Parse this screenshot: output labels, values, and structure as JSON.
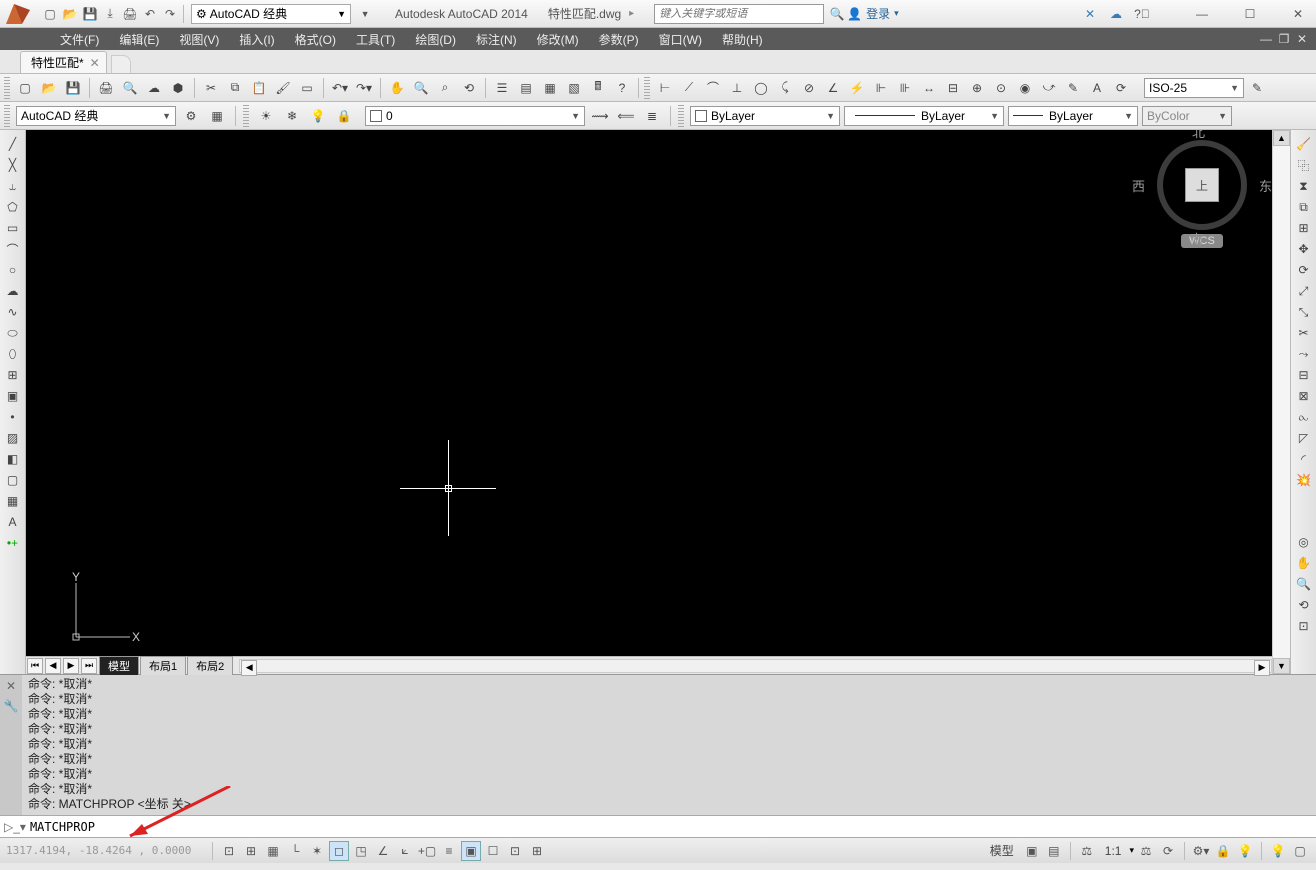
{
  "title": {
    "app": "Autodesk AutoCAD 2014",
    "file": "特性匹配.dwg",
    "workspace": "AutoCAD 经典",
    "search_placeholder": "键入关键字或短语",
    "login": "登录"
  },
  "menu": [
    "文件(F)",
    "编辑(E)",
    "视图(V)",
    "插入(I)",
    "格式(O)",
    "工具(T)",
    "绘图(D)",
    "标注(N)",
    "修改(M)",
    "参数(P)",
    "窗口(W)",
    "帮助(H)"
  ],
  "tab": {
    "name": "特性匹配*",
    "modified": true
  },
  "dim_style": "ISO-25",
  "props": {
    "workspace": "AutoCAD 经典",
    "layer": "0",
    "color": "ByLayer",
    "linetype": "ByLayer",
    "lineweight": "ByLayer",
    "plotstyle": "ByColor"
  },
  "layout_tabs": {
    "active": "模型",
    "others": [
      "布局1",
      "布局2"
    ]
  },
  "viewcube": {
    "top": "上",
    "n": "北",
    "s": "南",
    "e": "东",
    "w": "西",
    "wcs": "WCS"
  },
  "ucs": {
    "x": "X",
    "y": "Y"
  },
  "command_history": [
    "命令: *取消*",
    "命令: *取消*",
    "命令: *取消*",
    "命令: *取消*",
    "命令: *取消*",
    "命令: *取消*",
    "命令: *取消*",
    "命令: *取消*",
    "命令: MATCHPROP <坐标 关>"
  ],
  "command_input": "MATCHPROP",
  "status": {
    "coords": "1317.4194, -18.4264 , 0.0000",
    "model": "模型",
    "scale": "1:1"
  },
  "qat_icons": [
    "new",
    "open",
    "save",
    "saveall",
    "print",
    "undo",
    "redo"
  ],
  "toolbar1": [
    "new",
    "open",
    "save",
    "print",
    "preview",
    "publish",
    "3d",
    "cut",
    "copy",
    "paste",
    "matchprop",
    "block",
    "undo",
    "redo",
    "pan",
    "zoomrt",
    "zoomwin",
    "zoomext",
    "props",
    "sheet",
    "layer",
    "tool",
    "calc",
    "help"
  ],
  "dim_toolbar": [
    "linear",
    "aligned",
    "arc",
    "ordinate",
    "radius",
    "diameter",
    "angular",
    "quick",
    "baseline",
    "continue",
    "spacing",
    "break",
    "tolerance",
    "center",
    "inspect",
    "jog",
    "edit",
    "textedit",
    "update",
    "style"
  ],
  "left_tools": [
    "line",
    "xline",
    "pline",
    "polygon",
    "rect",
    "arc",
    "circle",
    "revcloud",
    "spline",
    "ellipse",
    "ellarc",
    "insert",
    "block",
    "point",
    "hatch",
    "gradient",
    "region",
    "table",
    "mtext",
    "addpoint"
  ],
  "right_tools": [
    "erase",
    "copy",
    "mirror",
    "offset",
    "array",
    "move",
    "rotate",
    "scale",
    "stretch",
    "trim",
    "extend",
    "break",
    "join",
    "chamfer",
    "fillet",
    "explode"
  ],
  "status_toggles": [
    "infer",
    "snap",
    "grid",
    "ortho",
    "polar",
    "osnap",
    "3dosnap",
    "otrack",
    "ducs",
    "dyn",
    "lwt",
    "tpy",
    "qp",
    "sc"
  ]
}
